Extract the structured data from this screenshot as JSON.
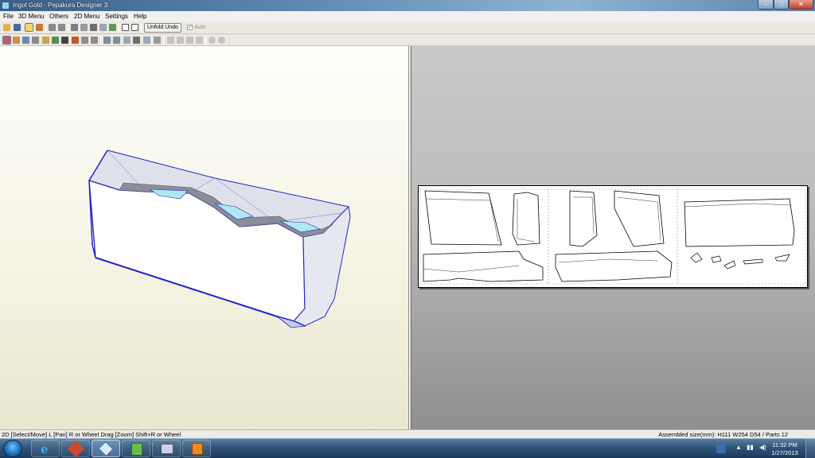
{
  "window": {
    "title": "Ingot Gold - Pepakura Designer 3",
    "min_glyph": "–",
    "max_glyph": "□",
    "close_glyph": "✕"
  },
  "menu": {
    "items": [
      "File",
      "3D Menu",
      "Others",
      "2D Menu",
      "Settings",
      "Help"
    ]
  },
  "toolbar": {
    "unfold_undo_label": "Unfold Undo",
    "auto_label": "Auto",
    "auto_checked": true,
    "auto_check_glyph": "✓"
  },
  "status": {
    "left": "2D [Select/Move] L [Pan] R or Wheel Drag [Zoom] Shift+R or Wheel",
    "right": "Assembled size(mm): H111 W254 D54 / Parts 12"
  },
  "taskbar": {
    "apps": [
      "internet-explorer",
      "pepakura-viewer",
      "pepakura-designer",
      "notepad-plus",
      "media-center",
      "paint-app"
    ],
    "clock_time": "11:32 PM",
    "clock_date": "1/27/2013"
  },
  "colors": {
    "model_edge": "#2222cc",
    "model_fill": "#ffffff",
    "model_top": "#dadde8",
    "groove": "#8a8e98",
    "groove_inner": "#aee8f5"
  }
}
